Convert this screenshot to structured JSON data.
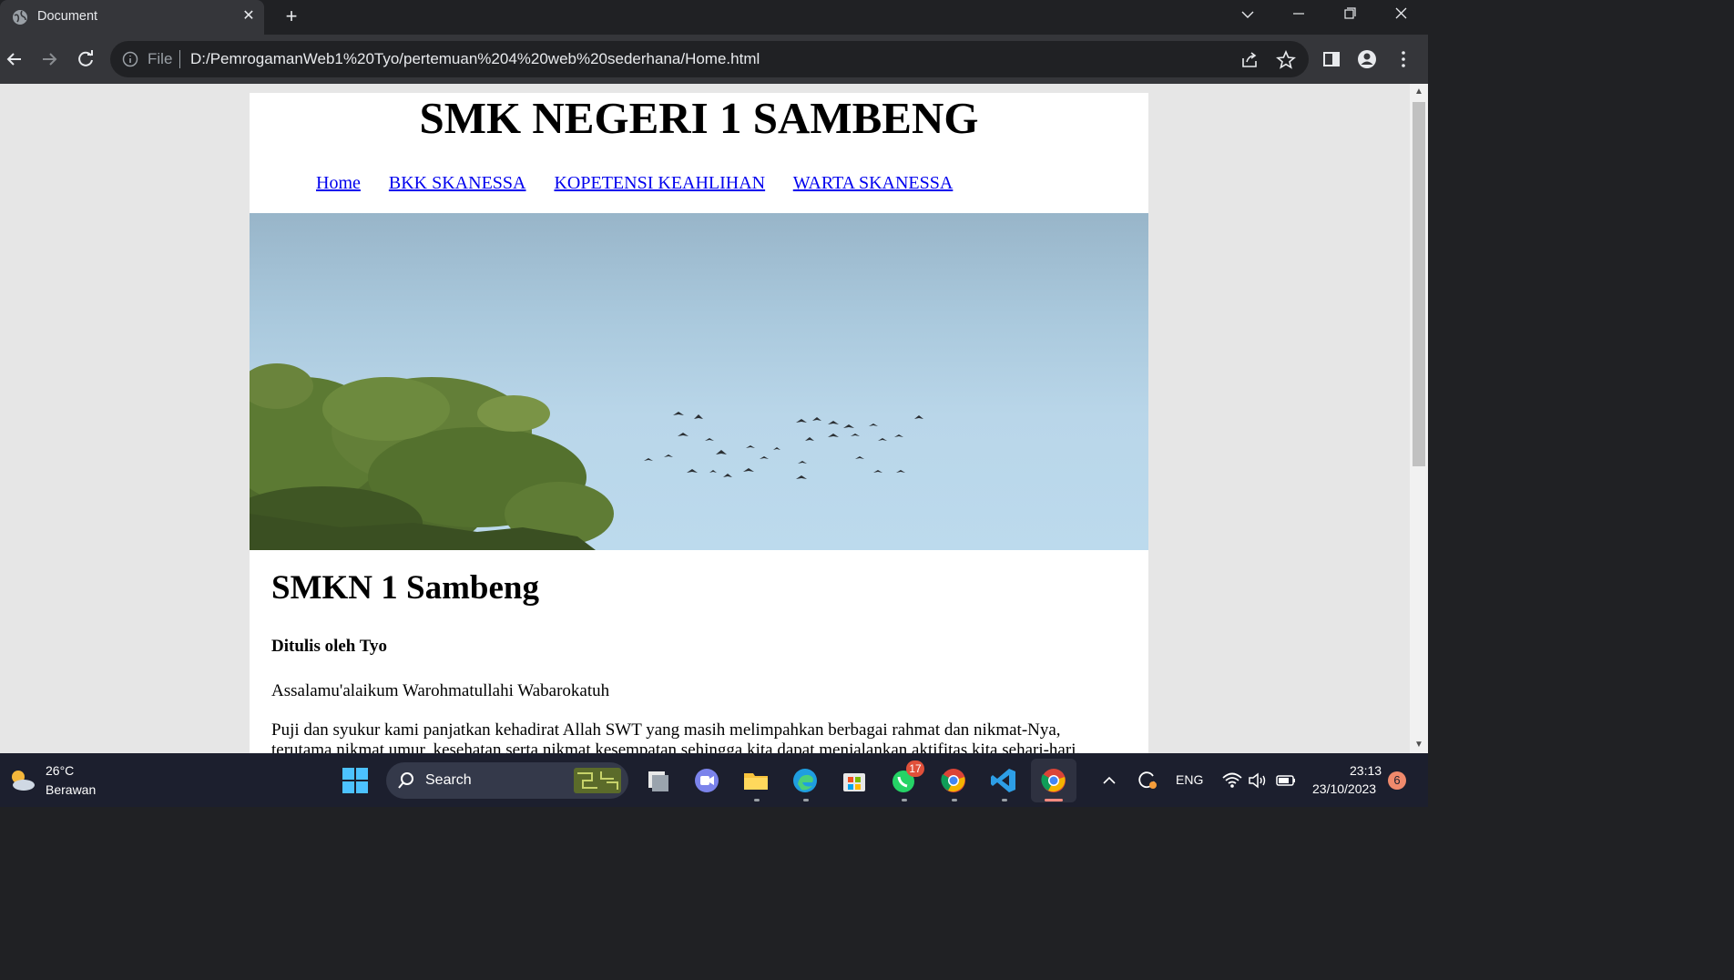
{
  "browser": {
    "tab_title": "Document",
    "tab_close": "✕",
    "new_tab": "+",
    "file_label": "File",
    "url": "D:/PemrogamanWeb1%20Tyo/pertemuan%204%20web%20sederhana/Home.html"
  },
  "site": {
    "title": "SMK NEGERI 1 SAMBENG",
    "nav": [
      "Home",
      "BKK SKANESSA",
      "KOPETENSI KEAHLIHAN",
      "WARTA SKANESSA"
    ],
    "hero_image": "sky-with-tree-and-flying-birds"
  },
  "article": {
    "heading": "SMKN 1 Sambeng",
    "author": "Ditulis oleh Tyo",
    "greeting": "Assalamu'alaikum Warohmatullahi Wabarokatuh",
    "body_line1": "Puji dan syukur kami panjatkan kehadirat Allah SWT yang masih melimpahkan berbagai rahmat dan nikmat-Nya,",
    "body_line2": "terutama nikmat umur, kesehatan serta nikmat kesempatan sehingga kita dapat menjalankan aktifitas kita sehari-hari."
  },
  "taskbar": {
    "temperature": "26°C",
    "weather": "Berawan",
    "search_label": "Search",
    "whatsapp_badge": "17",
    "language": "ENG",
    "time": "23:13",
    "date": "23/10/2023",
    "notification_count": "6"
  }
}
